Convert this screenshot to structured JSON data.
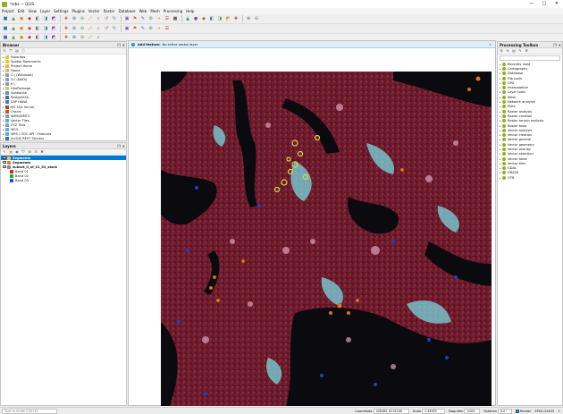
{
  "window": {
    "title": "*alba — QGIS",
    "minimize": "—",
    "maximize": "□",
    "close": "✕"
  },
  "menu": [
    "Project",
    "Edit",
    "View",
    "Layer",
    "Settings",
    "Plugins",
    "Vector",
    "Raster",
    "Database",
    "Web",
    "Mesh",
    "Processing",
    "Help"
  ],
  "toolbars": {
    "row1": [
      "new-project-icon",
      "open-project-icon",
      "save-project-icon",
      "save-as-icon",
      "print-layout-icon",
      "layout-manager-icon",
      "style-manager-icon",
      "pan-icon",
      "pan-to-selection-icon",
      "zoom-in-icon",
      "zoom-out-icon",
      "zoom-full-icon",
      "zoom-layer-icon",
      "zoom-selection-icon",
      "zoom-last-icon",
      "zoom-next-icon",
      "new-map-view-icon",
      "temporal-icon",
      "refresh-icon",
      "identify-icon",
      "select-icon",
      "deselect-icon",
      "attribute-table-icon",
      "field-calculator-icon",
      "statistics-icon",
      "measure-icon",
      "tips-icon",
      "annotation-icon",
      "label-icon",
      "python-icon"
    ],
    "row2": [
      "digitize-icon",
      "editing-icon",
      "save-edits-icon",
      "add-point-icon",
      "vertex-tool-icon",
      "delete-icon",
      "cut-icon",
      "copy-icon",
      "paste-icon",
      "undo-icon",
      "redo-icon",
      "label-toggle-icon",
      "pin-label-icon",
      "show-label-icon",
      "move-label-icon",
      "rotate-label-icon",
      "change-label-icon",
      "text-tool-icon",
      "label-format-icon",
      "diagram-icon"
    ],
    "row3": [
      "add-vector-icon",
      "add-raster-icon",
      "add-mesh-icon",
      "add-csv-icon",
      "add-spatialite-icon",
      "add-postgis-icon",
      "add-wms-icon",
      "add-wfs-icon",
      "add-arcgis-icon",
      "new-layer-icon",
      "python-console-icon",
      "processing-icon"
    ]
  },
  "browser": {
    "title": "Browser",
    "items": [
      {
        "label": "Favorites",
        "icon": "star-icon",
        "color": "#f2c230"
      },
      {
        "label": "Spatial Bookmarks",
        "icon": "bookmark-icon",
        "color": "#f2c230"
      },
      {
        "label": "Project Home",
        "icon": "folder-icon",
        "color": "#e4bb59"
      },
      {
        "label": "Home",
        "icon": "home-icon",
        "color": "#e4bb59"
      },
      {
        "label": "C:\\ (Windows)",
        "icon": "drive-icon",
        "color": "#8aa0b8"
      },
      {
        "label": "D:\\ (DATA)",
        "icon": "drive-icon",
        "color": "#8aa0b8"
      },
      {
        "label": "E:\\",
        "icon": "drive-icon",
        "color": "#8aa0b8"
      },
      {
        "label": "GeoPackage",
        "icon": "geopackage-icon",
        "color": "#b9d36a"
      },
      {
        "label": "SpatiaLite",
        "icon": "spatialite-icon",
        "color": "#5b8fd3"
      },
      {
        "label": "PostgreSQL",
        "icon": "postgres-icon",
        "color": "#3d6aa8"
      },
      {
        "label": "SAP HANA",
        "icon": "hana-icon",
        "color": "#3b7bbf"
      },
      {
        "label": "MS SQL Server",
        "icon": "mssql-icon",
        "color": "#c0392b"
      },
      {
        "label": "Oracle",
        "icon": "oracle-icon",
        "color": "#d35400"
      },
      {
        "label": "WMS/WMTS",
        "icon": "wms-icon",
        "color": "#6aa8d8"
      },
      {
        "label": "Vector Tiles",
        "icon": "vector-tiles-icon",
        "color": "#6aa8d8"
      },
      {
        "label": "XYZ Tiles",
        "icon": "xyz-icon",
        "color": "#6aa8d8"
      },
      {
        "label": "WCS",
        "icon": "wcs-icon",
        "color": "#6aa8d8"
      },
      {
        "label": "WFS / OGC API - Features",
        "icon": "wfs-icon",
        "color": "#6aa8d8"
      },
      {
        "label": "ArcGIS REST Servers",
        "icon": "arcgis-icon",
        "color": "#3a6fb5"
      }
    ]
  },
  "layers": {
    "title": "Layers",
    "items": [
      {
        "label": "Segments",
        "level": 0,
        "checked": true,
        "selected": true,
        "symbol": "#f0c060"
      },
      {
        "label": "Segments",
        "level": 0,
        "checked": true,
        "selected": false,
        "symbol": "#e07a30"
      },
      {
        "label": "subset_0_of_S1_S2_stack",
        "level": 0,
        "checked": true,
        "selected": false,
        "symbol": "#888888"
      },
      {
        "label": "Band 01",
        "level": 1,
        "checked": false,
        "selected": false,
        "symbol": "#e02020"
      },
      {
        "label": "Band 02",
        "level": 1,
        "checked": false,
        "selected": false,
        "symbol": "#20b020"
      },
      {
        "label": "Band 03",
        "level": 1,
        "checked": false,
        "selected": false,
        "symbol": "#2050e0"
      }
    ]
  },
  "processing": {
    "title": "Processing Toolbox",
    "search_placeholder": "",
    "items": [
      "Recently used",
      "Cartography",
      "Database",
      "File tools",
      "GPS",
      "Interpolation",
      "Layer tools",
      "Mesh",
      "Network analysis",
      "Plots",
      "Raster analysis",
      "Raster creation",
      "Raster terrain analysis",
      "Raster tools",
      "Vector analysis",
      "Vector creation",
      "Vector general",
      "Vector geometry",
      "Vector overlay",
      "Vector selection",
      "Vector table",
      "Vector tiles",
      "GDAL",
      "GRASS",
      "OTB"
    ]
  },
  "message": {
    "title": "Add feature:",
    "text": "No active vector layer"
  },
  "status": {
    "locator_placeholder": "Type to locate (Ctrl+K)",
    "coordinate_label": "Coordinate",
    "coordinate": "408485, 6234208",
    "scale_label": "Scale",
    "scale": "1:49983",
    "magnifier_label": "Magnifier",
    "magnifier": "100%",
    "rotation_label": "Rotation",
    "rotation": "0.0 °",
    "render_label": "Render",
    "crs": "EPSG:32633"
  },
  "colors": {
    "raster_base": "#6a1a2a",
    "water": "#0a0a0f",
    "cyan": "#7ad8e0",
    "segment_yellow": "#d8d840",
    "segment_orange": "#e07a20",
    "blue_point": "#2040c0",
    "message_bg": "#dfeff8"
  }
}
